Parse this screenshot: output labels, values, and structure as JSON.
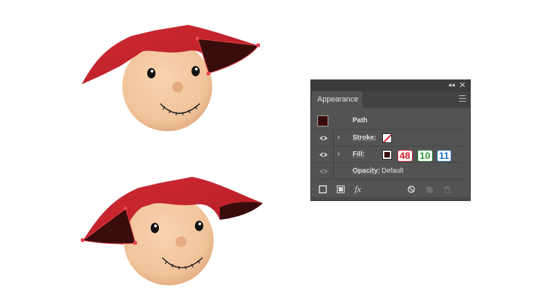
{
  "panel": {
    "collapse_glyph": "◂◂",
    "close_glyph": "✕",
    "tab_label": "Appearance",
    "target_label": "Path",
    "rows": {
      "stroke_label": "Stroke:",
      "fill_label": "Fill:",
      "opacity_label": "Opacity:",
      "opacity_value": "Default"
    },
    "fill_rgb": {
      "r": "48",
      "g": "10",
      "b": "11"
    },
    "chevron_glyph": "›",
    "fx_label": "fx"
  },
  "colors": {
    "hat_main": "#c4232c",
    "hat_shadow": "#3a0d0d",
    "face": "#f5c9a1",
    "anchor": "#e8424a",
    "panel_bg": "#535353",
    "rgb_red": "#d61c2a",
    "rgb_green": "#2e9b3a",
    "rgb_blue": "#1f6fc4"
  },
  "icons": [
    "eye-icon",
    "chevron-right-icon",
    "new-stroke-icon",
    "new-fill-icon",
    "fx-icon",
    "clear-icon",
    "duplicate-icon",
    "trash-icon"
  ]
}
